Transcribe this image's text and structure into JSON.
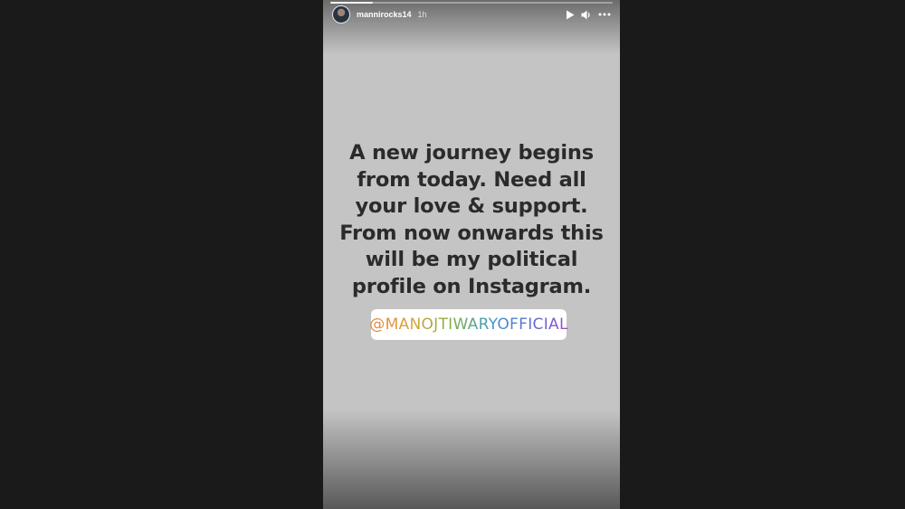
{
  "story": {
    "username": "mannirocks14",
    "timestamp": "1h",
    "progress": 0.15,
    "background_color": "#c4c4c4",
    "text_lines": [
      "A new journey begins",
      "from today. Need all",
      "your love & support.",
      "From now onwards this",
      "will be my political",
      "profile on Instagram."
    ],
    "mention": "@MANOJTIWARYOFFICIAL"
  },
  "header": {
    "icons": {
      "avatar": "profile-avatar",
      "play": "play-icon",
      "sound": "speaker-icon",
      "more": "more-icon"
    }
  }
}
